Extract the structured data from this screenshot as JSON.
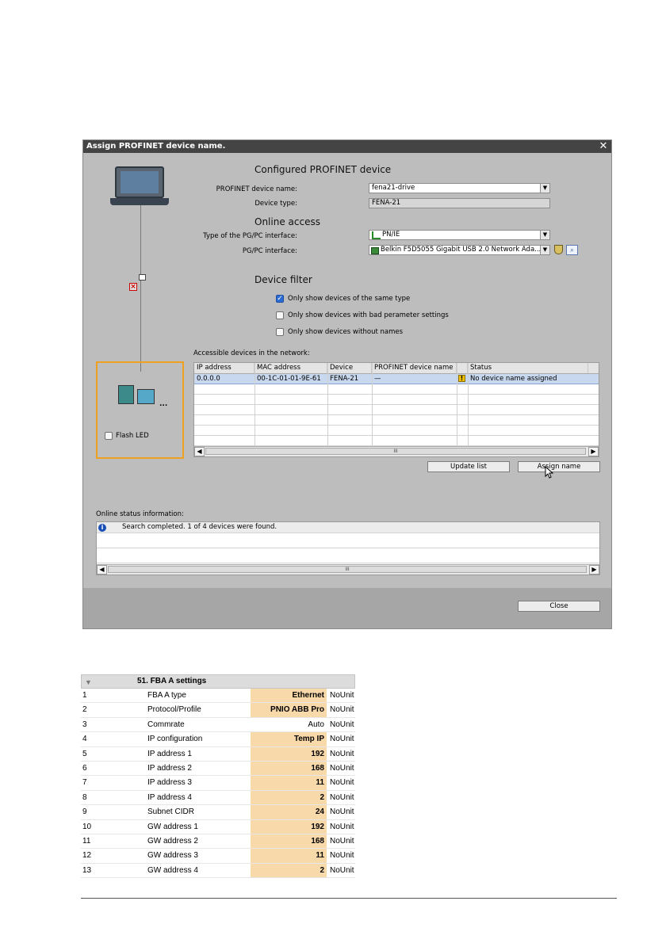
{
  "dialog": {
    "title": "Assign PROFINET device name.",
    "close_glyph": "✕",
    "configured": {
      "heading": "Configured PROFINET device",
      "device_name_label": "PROFINET device name:",
      "device_name_value": "fena21-drive",
      "device_type_label": "Device type:",
      "device_type_value": "FENA-21"
    },
    "online_access": {
      "heading": "Online access",
      "interface_type_label": "Type of the PG/PC interface:",
      "interface_type_value": "PN/IE",
      "interface_label": "PG/PC interface:",
      "interface_value": "Belkin F5D5055 Gigabit USB 2.0 Network Ada..."
    },
    "device_filter": {
      "heading": "Device filter",
      "options": [
        {
          "label": "Only show devices of the same type",
          "checked": true
        },
        {
          "label": "Only show devices with bad perameter settings",
          "checked": false
        },
        {
          "label": "Only show devices without names",
          "checked": false
        }
      ]
    },
    "accessible": {
      "label": "Accessible devices in the network:",
      "columns": [
        "IP address",
        "MAC address",
        "Device",
        "PROFINET device name",
        "",
        "Status"
      ],
      "rows": [
        {
          "ip": "0.0.0.0",
          "mac": "00-1C-01-01-9E-61",
          "device": "FENA-21",
          "name": "—",
          "status": "No device name assigned"
        }
      ]
    },
    "flash_led_label": "Flash LED",
    "update_list_label": "Update list",
    "assign_name_label": "Assign name",
    "online_status": {
      "label": "Online status information:",
      "message": "Search completed. 1 of 4 devices were found."
    },
    "close_label": "Close",
    "icons": {
      "warning": "warning-icon",
      "info": "info-icon",
      "error": "error-icon",
      "network": "network-icon"
    },
    "selection_color": "#c8d8ee",
    "highlight_color": "#f0a020"
  },
  "params": {
    "group_title": "51. FBA A settings",
    "rows": [
      {
        "num": "1",
        "name": "FBA A type",
        "value": "Ethernet",
        "unit": "NoUnit",
        "highlight": true
      },
      {
        "num": "2",
        "name": "Protocol/Profile",
        "value": "PNIO ABB Pro",
        "unit": "NoUnit",
        "highlight": true
      },
      {
        "num": "3",
        "name": "Commrate",
        "value": "Auto",
        "unit": "NoUnit",
        "highlight": false
      },
      {
        "num": "4",
        "name": "IP configuration",
        "value": "Temp IP",
        "unit": "NoUnit",
        "highlight": true
      },
      {
        "num": "5",
        "name": "IP address 1",
        "value": "192",
        "unit": "NoUnit",
        "highlight": true
      },
      {
        "num": "6",
        "name": "IP address 2",
        "value": "168",
        "unit": "NoUnit",
        "highlight": true
      },
      {
        "num": "7",
        "name": "IP address 3",
        "value": "11",
        "unit": "NoUnit",
        "highlight": true
      },
      {
        "num": "8",
        "name": "IP address 4",
        "value": "2",
        "unit": "NoUnit",
        "highlight": true
      },
      {
        "num": "9",
        "name": "Subnet CIDR",
        "value": "24",
        "unit": "NoUnit",
        "highlight": true
      },
      {
        "num": "10",
        "name": "GW address 1",
        "value": "192",
        "unit": "NoUnit",
        "highlight": true
      },
      {
        "num": "11",
        "name": "GW address 2",
        "value": "168",
        "unit": "NoUnit",
        "highlight": true
      },
      {
        "num": "12",
        "name": "GW address 3",
        "value": "11",
        "unit": "NoUnit",
        "highlight": true
      },
      {
        "num": "13",
        "name": "GW address 4",
        "value": "2",
        "unit": "NoUnit",
        "highlight": true
      }
    ],
    "highlight_color": "#f8d9aa"
  }
}
